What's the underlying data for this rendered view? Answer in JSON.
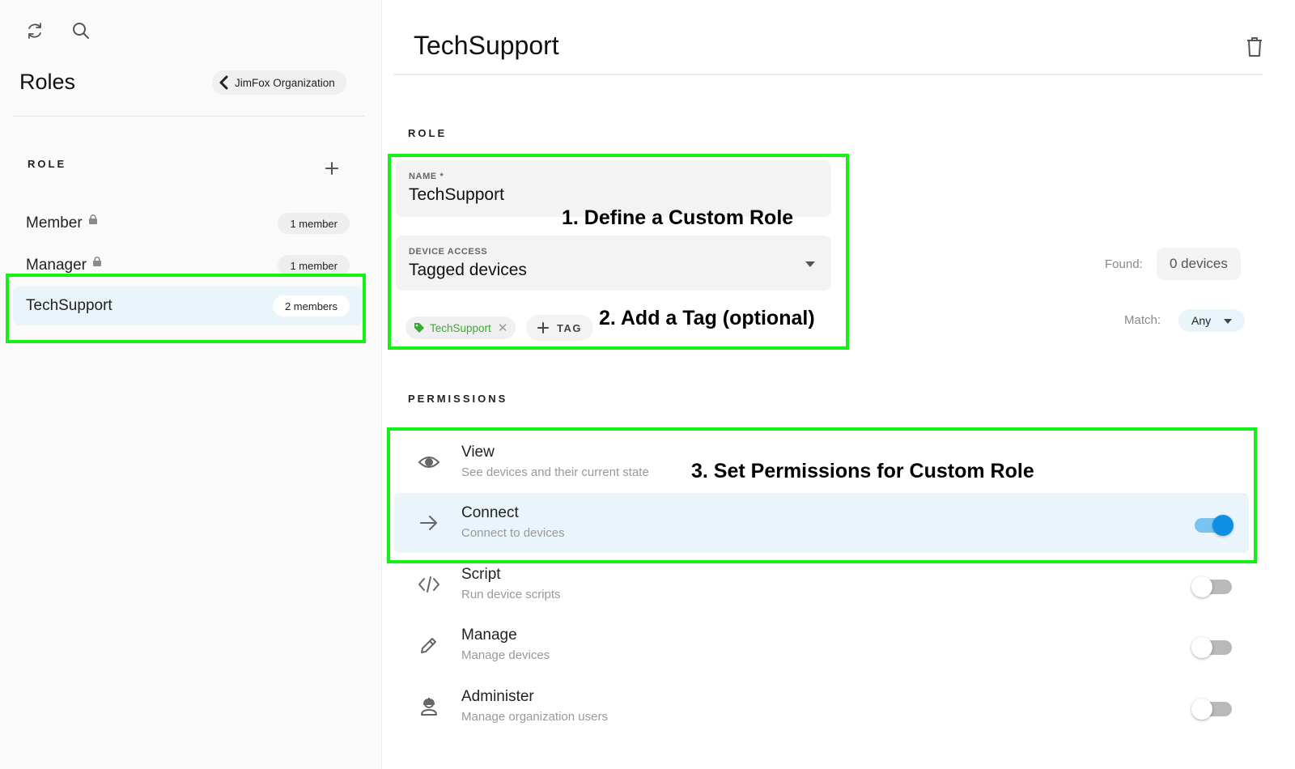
{
  "sidebar": {
    "title": "Roles",
    "back_label": "JimFox Organization",
    "section_label": "ROLE",
    "roles": [
      {
        "name": "Member",
        "members": "1 member",
        "locked": true
      },
      {
        "name": "Manager",
        "members": "1 member",
        "locked": true
      },
      {
        "name": "TechSupport",
        "members": "2 members",
        "locked": false,
        "selected": true
      }
    ],
    "icons": [
      "refresh-icon",
      "search-icon",
      "chevron-left-icon",
      "plus-icon",
      "lock-icon"
    ]
  },
  "main": {
    "title": "TechSupport",
    "role_section_label": "ROLE",
    "name_field": {
      "label": "NAME *",
      "value": "TechSupport"
    },
    "device_access": {
      "label": "DEVICE ACCESS",
      "value": "Tagged devices"
    },
    "tag": {
      "name": "TechSupport",
      "color": "#3aaa35"
    },
    "add_tag_label": "TAG",
    "found_label": "Found:",
    "found_value": "0 devices",
    "match_label": "Match:",
    "match_value": "Any",
    "permissions_label": "PERMISSIONS",
    "permissions": [
      {
        "title": "View",
        "description": "See devices and their current state",
        "icon": "eye-icon"
      },
      {
        "title": "Connect",
        "description": "Connect to devices",
        "icon": "arrow-right-icon",
        "enabled": true
      },
      {
        "title": "Script",
        "description": "Run device scripts",
        "icon": "code-icon",
        "enabled": false
      },
      {
        "title": "Manage",
        "description": "Manage devices",
        "icon": "pencil-icon",
        "enabled": false
      },
      {
        "title": "Administer",
        "description": "Manage organization users",
        "icon": "user-admin-icon",
        "enabled": false
      }
    ]
  },
  "annotations": {
    "step1": "1. Define a Custom Role",
    "step2": "2. Add a Tag (optional)",
    "step3": "3. Set Permissions for Custom Role"
  },
  "colors": {
    "highlight": "#17f017",
    "accent": "#0f8fe3",
    "selected_bg": "#e9f4fb"
  }
}
